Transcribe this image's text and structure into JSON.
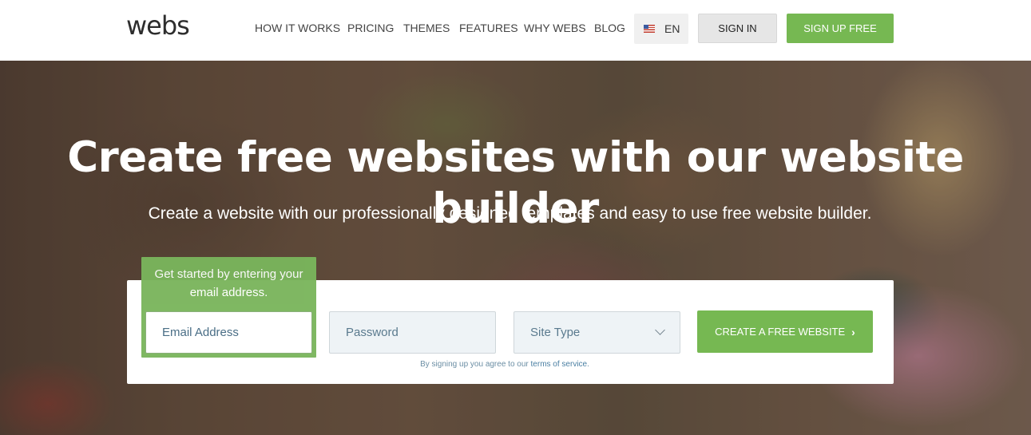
{
  "brand": {
    "logo": "webs"
  },
  "nav": {
    "items": [
      "HOW IT WORKS",
      "PRICING",
      "THEMES",
      "FEATURES",
      "WHY WEBS",
      "BLOG"
    ],
    "language": "EN",
    "sign_in": "SIGN IN",
    "sign_up": "SIGN UP FREE"
  },
  "hero": {
    "title": "Create free websites with our website builder",
    "subtitle": "Create a website with our professionally designed templates and easy to use free website builder."
  },
  "form": {
    "tip": "Get started by entering your email address.",
    "email_placeholder": "Email Address",
    "password_placeholder": "Password",
    "site_type": "Site Type",
    "submit": "CREATE A FREE WEBSITE",
    "submit_arrow": "›",
    "terms_prefix": "By signing up you agree to our",
    "terms_link": "terms of service",
    "terms_suffix": "."
  },
  "colors": {
    "accent": "#76b852",
    "text": "#444444"
  },
  "icons": [
    "us-flag-icon",
    "chevron-down-icon",
    "chevron-right-icon"
  ]
}
